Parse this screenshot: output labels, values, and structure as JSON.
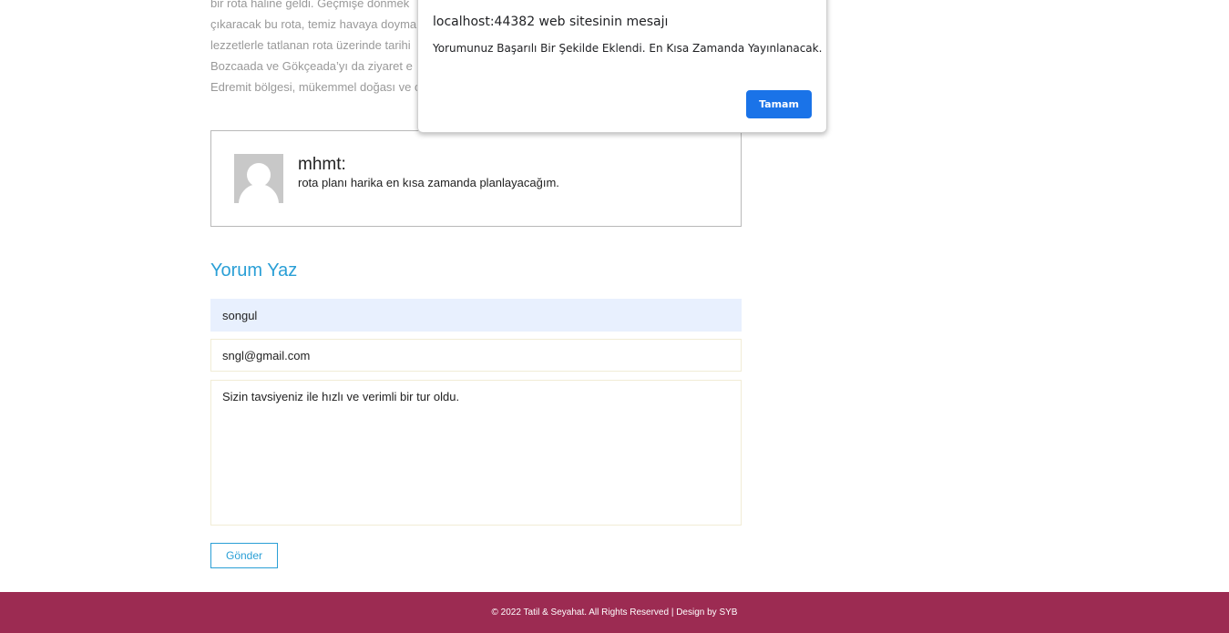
{
  "article": {
    "lines": [
      "bir rota haline geldi. Geçmişe dönmek",
      "çıkaracak bu rota, temiz havaya doymak",
      "lezzetlerle tatlanan rota üzerinde tarihi",
      "Bozcaada ve Gökçeada’yı da ziyaret e",
      "Edremit bölgesi, mükemmel doğası ve c"
    ]
  },
  "comment": {
    "author": "mhmt:",
    "text": "rota planı harika en kısa zamanda planlayacağım."
  },
  "form": {
    "title": "Yorum Yaz",
    "name_value": "songul",
    "email_value": "sngl@gmail.com",
    "message_value": "Sizin tavsiyeniz ile hızlı ve verimli bir tur oldu.",
    "submit_label": "Gönder"
  },
  "footer": {
    "text": "© 2022 Tatil & Seyahat. All Rights Reserved | Design by SYB"
  },
  "dialog": {
    "title": "localhost:44382 web sitesinin mesajı",
    "message": "Yorumunuz Başarılı Bir Şekilde Eklendi. En Kısa Zamanda Yayınlanacak.",
    "ok_label": "Tamam"
  },
  "colors": {
    "accent": "#2a9fd6",
    "footer_bg": "#9c2b52",
    "dialog_button": "#1a73e8"
  }
}
